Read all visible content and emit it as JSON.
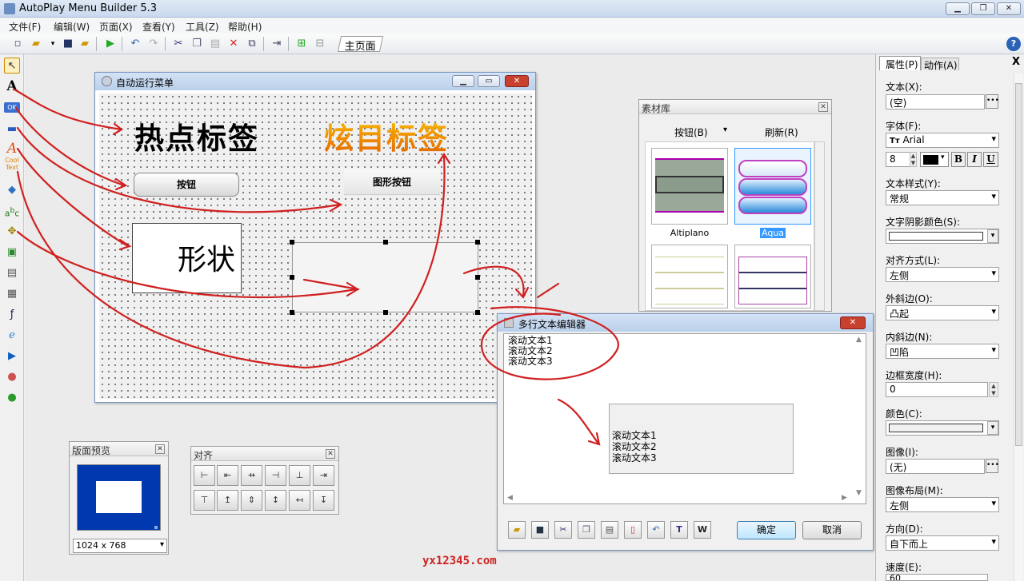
{
  "app": {
    "title": "AutoPlay Menu Builder 5.3",
    "window_buttons": [
      "▁",
      "❐",
      "✕"
    ]
  },
  "menu": [
    "文件(F)",
    "编辑(W)",
    "页面(X)",
    "查看(Y)",
    "工具(Z)",
    "帮助(H)"
  ],
  "toolbar": {
    "tab_label": "主页面",
    "help_icon": "?"
  },
  "design_window": {
    "title": "自动运行菜单",
    "hotspot_label": "热点标签",
    "fancy_label": "炫目标签",
    "button_label": "按钮",
    "image_button_label": "图形按钮",
    "shape_label": "形状"
  },
  "material_panel": {
    "title": "素材库",
    "tab_buttons": "按钮(B)",
    "tab_refresh": "刷新(R)",
    "items": [
      "Altiplano",
      "Aqua"
    ]
  },
  "preview_panel": {
    "title": "版面预览",
    "resolution": "1024 x 768"
  },
  "align_panel": {
    "title": "对齐"
  },
  "editor": {
    "title": "多行文本编辑器",
    "text_lines": [
      "滚动文本1",
      "滚动文本2",
      "滚动文本3"
    ],
    "preview_lines": [
      "滚动文本1",
      "滚动文本2",
      "滚动文本3"
    ],
    "ok_label": "确定",
    "cancel_label": "取消"
  },
  "properties": {
    "tab_props": "属性(P)",
    "tab_actions": "动作(A)",
    "close": "X",
    "text_label": "文本(X):",
    "text_value": "(空)",
    "font_label": "字体(F):",
    "font_value": "Arial",
    "font_size": "8",
    "text_style_label": "文本样式(Y):",
    "text_style_value": "常规",
    "shadow_label": "文字阴影颜色(S):",
    "align_label": "对齐方式(L):",
    "align_value": "左侧",
    "outer_bevel_label": "外斜边(O):",
    "outer_bevel_value": "凸起",
    "inner_bevel_label": "内斜边(N):",
    "inner_bevel_value": "凹陷",
    "border_width_label": "边框宽度(H):",
    "border_width_value": "0",
    "color_label": "颜色(C):",
    "image_label": "图像(I):",
    "image_value": "(无)",
    "image_layout_label": "图像布局(M):",
    "image_layout_value": "左侧",
    "direction_label": "方向(D):",
    "direction_value": "自下而上",
    "speed_label": "速度(E):",
    "speed_value": "60"
  },
  "watermark": "yx12345.com"
}
